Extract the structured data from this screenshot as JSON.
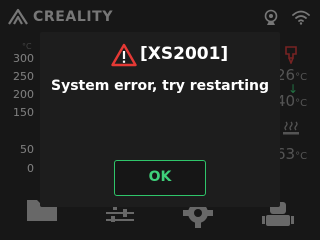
{
  "brand": {
    "name": "CREALITY"
  },
  "graph": {
    "unit": "°C",
    "ticks": [
      "300",
      "250",
      "200",
      "150",
      "50",
      "0"
    ]
  },
  "temps": {
    "nozzle_current": "26",
    "nozzle_target": "40",
    "bed_current": "63",
    "unit": "°C"
  },
  "dialog": {
    "code": "[XS2001]",
    "message": "System error, try restarting",
    "ok_label": "OK"
  },
  "icons": {
    "brand": "creality-logo-icon",
    "camera": "webcam-icon",
    "wifi": "wifi-icon",
    "nozzle": "nozzle-heater-icon",
    "bed": "heated-bed-icon",
    "warning": "warning-triangle-icon",
    "files": "folder-icon",
    "controls": "sliders-icon",
    "settings": "gear-icon",
    "robot": "robot-icon"
  },
  "colors": {
    "accent": "#2fc56a",
    "warning": "#e53935",
    "nozzle": "#d94040"
  }
}
